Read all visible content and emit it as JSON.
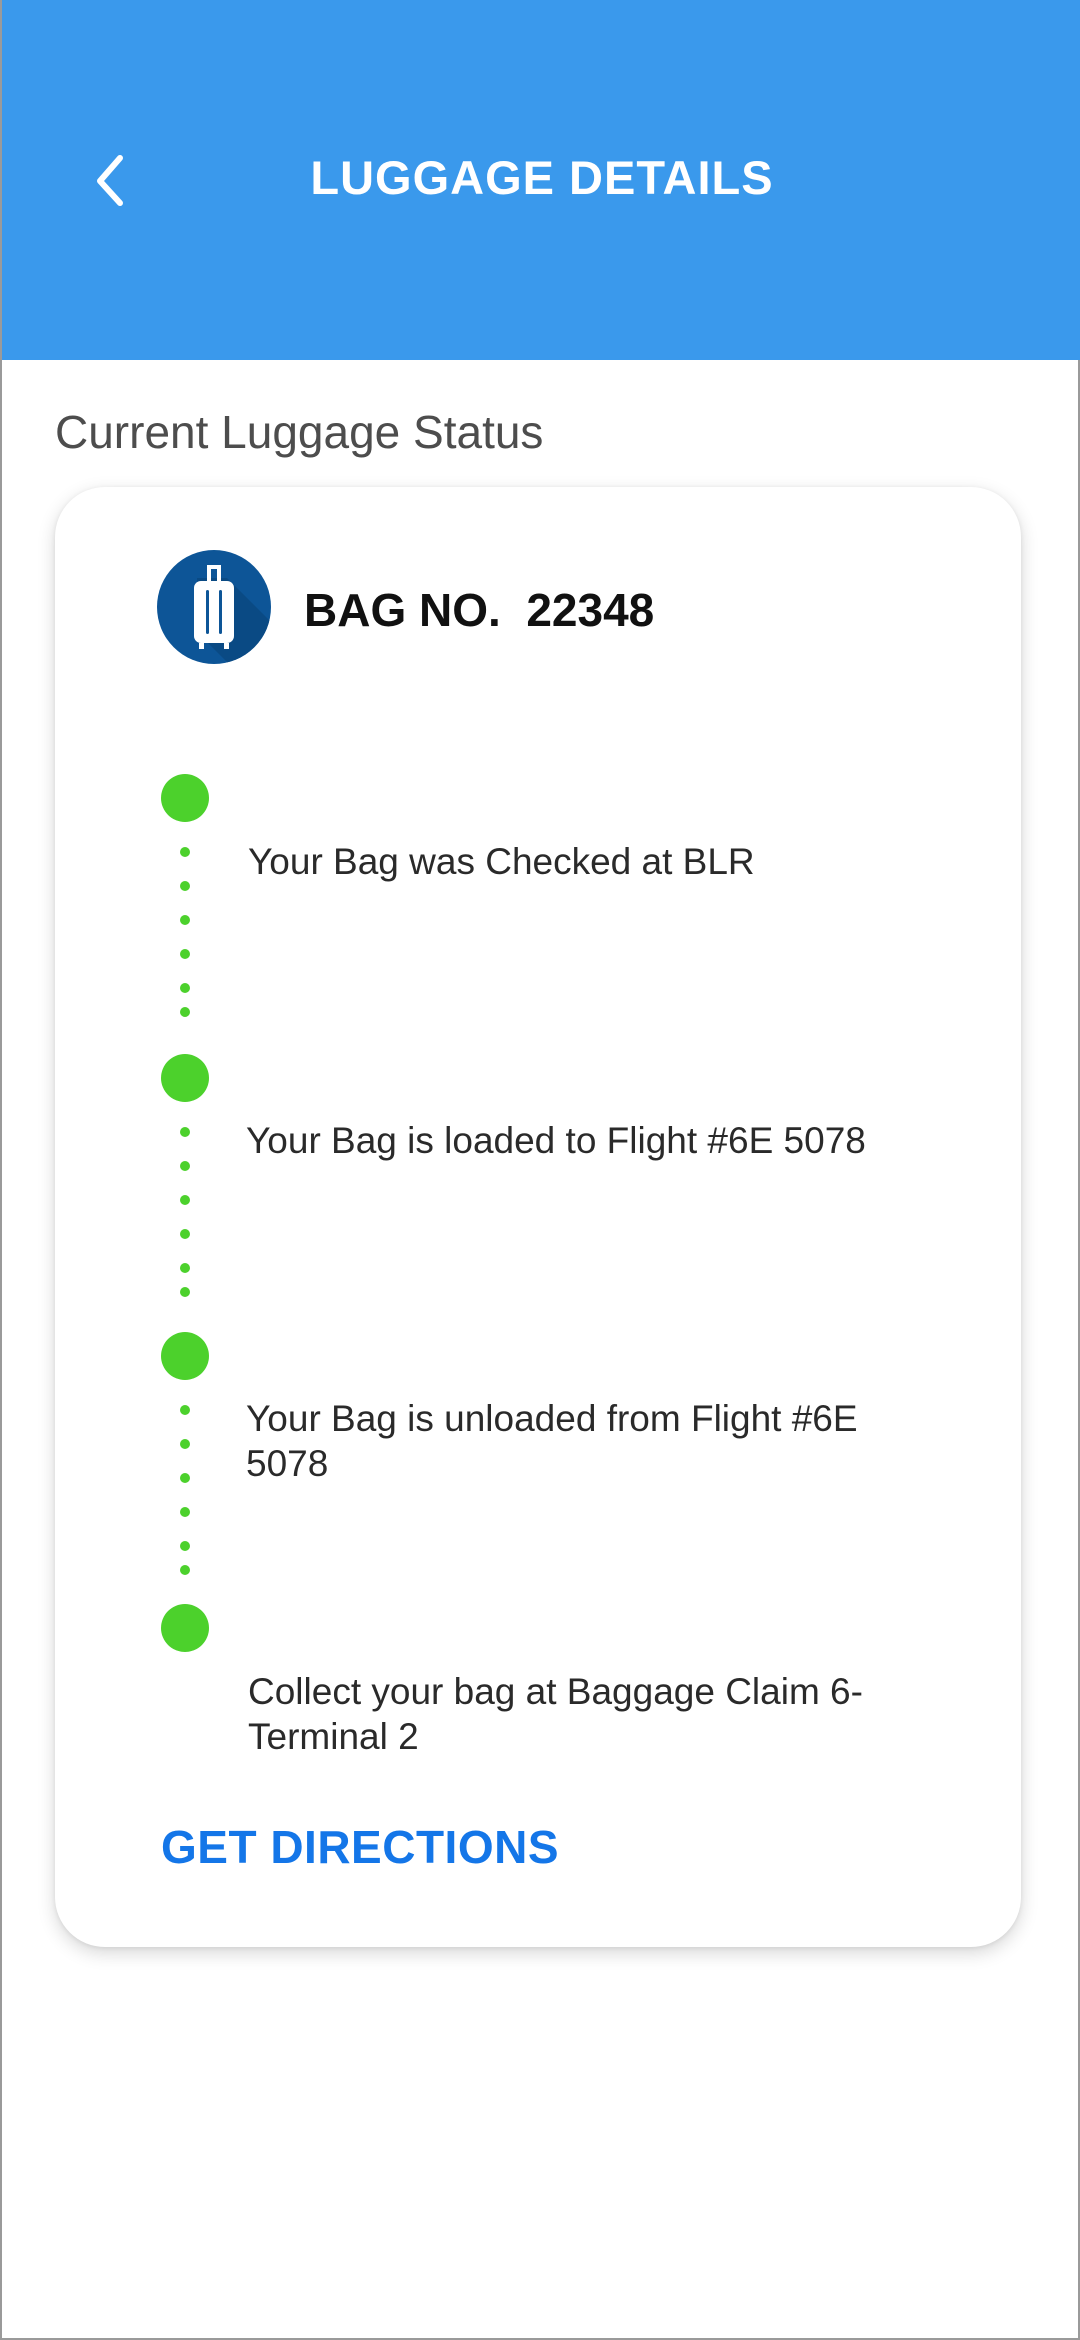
{
  "header": {
    "title": "LUGGAGE DETAILS",
    "back_icon": "chevron-left-icon",
    "background_color": "#3a99ec"
  },
  "section": {
    "title": "Current Luggage Status"
  },
  "bag": {
    "icon": "suitcase-icon",
    "label": "BAG NO.  22348"
  },
  "timeline": {
    "status_color": "#4cd12c",
    "steps": [
      {
        "text": "Your Bag was Checked at BLR"
      },
      {
        "text": "Your Bag is loaded to Flight #6E 5078"
      },
      {
        "text": "Your Bag is unloaded from Flight #6E 5078"
      },
      {
        "text": "Collect your bag at Baggage Claim 6-Terminal 2"
      }
    ]
  },
  "actions": {
    "directions_label": "GET DIRECTIONS",
    "link_color": "#1476e8"
  }
}
